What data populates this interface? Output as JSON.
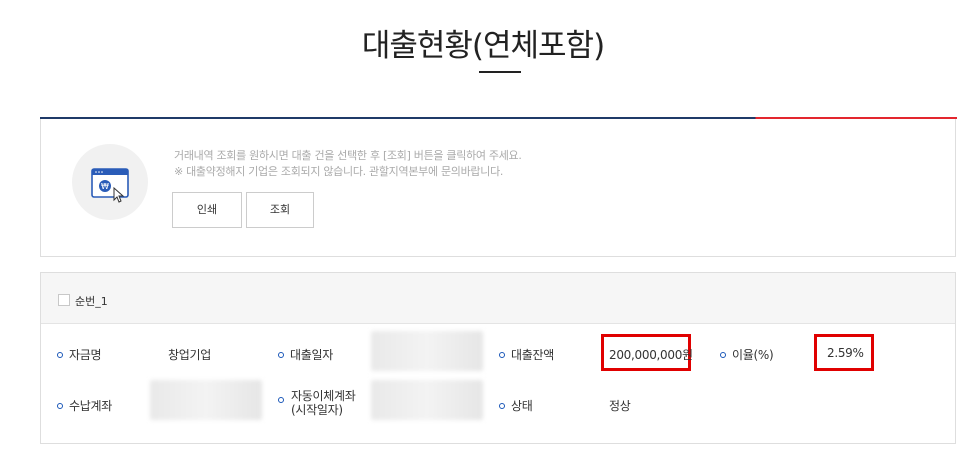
{
  "page": {
    "title": "대출현황(연체포함)"
  },
  "notice": {
    "line1": "거래내역 조회를 원하시면 대출 건을 선택한 후 [조회] 버튼을 클릭하여 주세요.",
    "line2": "※ 대출약정해지 기업은 조회되지 않습니다. 관할지역본부에 문의바랍니다.",
    "icon": "won-browser-icon",
    "print_label": "인쇄",
    "search_label": "조회"
  },
  "loan": {
    "seq_label": "순번_1",
    "fields": {
      "fund_name_label": "자금명",
      "fund_name_value": "창업기업",
      "loan_date_label": "대출일자",
      "balance_label": "대출잔액",
      "balance_value": "200,000,000원",
      "rate_label": "이율(%)",
      "rate_value": "2.59%",
      "account_label": "수납계좌",
      "auto_transfer_label_1": "자동이체계좌",
      "auto_transfer_label_2": "(시작일자)",
      "status_label": "상태",
      "status_value": "정상"
    }
  },
  "colors": {
    "accent_navy": "#1f3a68",
    "accent_red": "#e3262e",
    "highlight_red": "#e00000",
    "bullet_blue": "#1a57b8"
  }
}
